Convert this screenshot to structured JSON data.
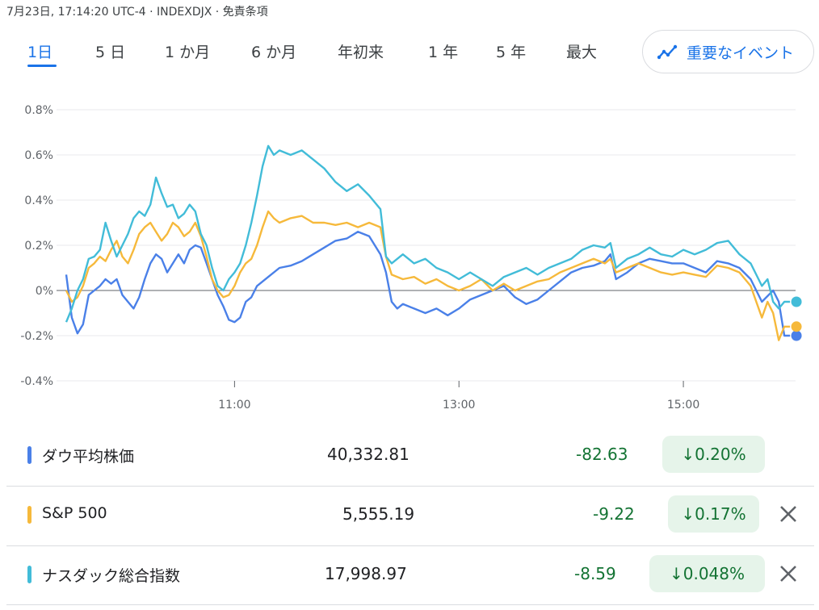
{
  "header": {
    "meta_text": "7月23日, 17:14:20 UTC-4 · INDEXDJX · 免責条項"
  },
  "tabs": [
    {
      "label": "1日",
      "active": true
    },
    {
      "label": "5 日",
      "active": false
    },
    {
      "label": "1 か月",
      "active": false
    },
    {
      "label": "6 か月",
      "active": false
    },
    {
      "label": "年初来",
      "active": false
    },
    {
      "label": "1 年",
      "active": false
    },
    {
      "label": "5 年",
      "active": false
    },
    {
      "label": "最大",
      "active": false
    }
  ],
  "events_button": {
    "label": "重要なイベント",
    "icon": "timeline-icon",
    "accent": "#1a73e8"
  },
  "chart_data": {
    "type": "line",
    "y_ticks": [
      "0.8%",
      "0.6%",
      "0.4%",
      "0.2%",
      "0%",
      "-0.2%",
      "-0.4%"
    ],
    "x_ticks": [
      "11:00",
      "13:00",
      "15:00"
    ],
    "ylim": [
      -0.4,
      0.8
    ],
    "x_unit": "time of day (hours)",
    "x_tick_values": [
      11,
      13,
      15
    ],
    "xlim": [
      9.5,
      16.0
    ],
    "zero_line": true,
    "series": [
      {
        "name": "ダウ平均株価",
        "color": "#4a80e8",
        "points": [
          [
            9.5,
            0.07
          ],
          [
            9.55,
            -0.12
          ],
          [
            9.6,
            -0.19
          ],
          [
            9.65,
            -0.15
          ],
          [
            9.7,
            -0.02
          ],
          [
            9.75,
            0.0
          ],
          [
            9.8,
            0.02
          ],
          [
            9.85,
            0.05
          ],
          [
            9.9,
            0.03
          ],
          [
            9.95,
            0.05
          ],
          [
            10.0,
            -0.02
          ],
          [
            10.05,
            -0.05
          ],
          [
            10.1,
            -0.08
          ],
          [
            10.15,
            -0.03
          ],
          [
            10.2,
            0.05
          ],
          [
            10.25,
            0.12
          ],
          [
            10.3,
            0.16
          ],
          [
            10.35,
            0.14
          ],
          [
            10.4,
            0.08
          ],
          [
            10.45,
            0.12
          ],
          [
            10.5,
            0.16
          ],
          [
            10.55,
            0.12
          ],
          [
            10.6,
            0.18
          ],
          [
            10.65,
            0.2
          ],
          [
            10.7,
            0.19
          ],
          [
            10.75,
            0.12
          ],
          [
            10.8,
            0.05
          ],
          [
            10.85,
            -0.02
          ],
          [
            10.9,
            -0.07
          ],
          [
            10.95,
            -0.13
          ],
          [
            11.0,
            -0.14
          ],
          [
            11.05,
            -0.12
          ],
          [
            11.1,
            -0.05
          ],
          [
            11.15,
            -0.03
          ],
          [
            11.2,
            0.02
          ],
          [
            11.3,
            0.06
          ],
          [
            11.4,
            0.1
          ],
          [
            11.5,
            0.11
          ],
          [
            11.6,
            0.13
          ],
          [
            11.7,
            0.16
          ],
          [
            11.8,
            0.19
          ],
          [
            11.9,
            0.22
          ],
          [
            12.0,
            0.23
          ],
          [
            12.1,
            0.26
          ],
          [
            12.2,
            0.24
          ],
          [
            12.3,
            0.16
          ],
          [
            12.35,
            0.08
          ],
          [
            12.4,
            -0.05
          ],
          [
            12.45,
            -0.08
          ],
          [
            12.5,
            -0.06
          ],
          [
            12.6,
            -0.08
          ],
          [
            12.7,
            -0.1
          ],
          [
            12.8,
            -0.08
          ],
          [
            12.9,
            -0.11
          ],
          [
            13.0,
            -0.08
          ],
          [
            13.1,
            -0.04
          ],
          [
            13.2,
            -0.02
          ],
          [
            13.3,
            0.0
          ],
          [
            13.4,
            0.02
          ],
          [
            13.5,
            -0.03
          ],
          [
            13.6,
            -0.06
          ],
          [
            13.7,
            -0.04
          ],
          [
            13.8,
            0.0
          ],
          [
            13.9,
            0.04
          ],
          [
            14.0,
            0.08
          ],
          [
            14.1,
            0.1
          ],
          [
            14.2,
            0.11
          ],
          [
            14.3,
            0.13
          ],
          [
            14.35,
            0.16
          ],
          [
            14.4,
            0.05
          ],
          [
            14.5,
            0.08
          ],
          [
            14.6,
            0.12
          ],
          [
            14.7,
            0.14
          ],
          [
            14.8,
            0.13
          ],
          [
            14.9,
            0.12
          ],
          [
            15.0,
            0.12
          ],
          [
            15.1,
            0.1
          ],
          [
            15.2,
            0.08
          ],
          [
            15.3,
            0.13
          ],
          [
            15.4,
            0.12
          ],
          [
            15.5,
            0.1
          ],
          [
            15.6,
            0.05
          ],
          [
            15.7,
            -0.05
          ],
          [
            15.8,
            0.0
          ],
          [
            15.85,
            -0.05
          ],
          [
            15.9,
            -0.2
          ],
          [
            15.95,
            -0.2
          ]
        ]
      },
      {
        "name": "S&P 500",
        "color": "#f6b93b",
        "points": [
          [
            9.5,
            0.0
          ],
          [
            9.55,
            -0.05
          ],
          [
            9.6,
            -0.03
          ],
          [
            9.65,
            0.02
          ],
          [
            9.7,
            0.1
          ],
          [
            9.75,
            0.12
          ],
          [
            9.8,
            0.15
          ],
          [
            9.85,
            0.13
          ],
          [
            9.9,
            0.18
          ],
          [
            9.95,
            0.22
          ],
          [
            10.0,
            0.15
          ],
          [
            10.05,
            0.12
          ],
          [
            10.1,
            0.18
          ],
          [
            10.15,
            0.25
          ],
          [
            10.2,
            0.28
          ],
          [
            10.25,
            0.3
          ],
          [
            10.3,
            0.26
          ],
          [
            10.35,
            0.22
          ],
          [
            10.4,
            0.25
          ],
          [
            10.45,
            0.3
          ],
          [
            10.5,
            0.28
          ],
          [
            10.55,
            0.24
          ],
          [
            10.6,
            0.26
          ],
          [
            10.65,
            0.3
          ],
          [
            10.7,
            0.24
          ],
          [
            10.75,
            0.15
          ],
          [
            10.8,
            0.05
          ],
          [
            10.85,
            0.0
          ],
          [
            10.9,
            -0.03
          ],
          [
            10.95,
            -0.02
          ],
          [
            11.0,
            0.02
          ],
          [
            11.05,
            0.08
          ],
          [
            11.1,
            0.12
          ],
          [
            11.15,
            0.14
          ],
          [
            11.2,
            0.2
          ],
          [
            11.25,
            0.28
          ],
          [
            11.3,
            0.35
          ],
          [
            11.35,
            0.32
          ],
          [
            11.4,
            0.3
          ],
          [
            11.5,
            0.32
          ],
          [
            11.6,
            0.33
          ],
          [
            11.7,
            0.3
          ],
          [
            11.8,
            0.3
          ],
          [
            11.9,
            0.29
          ],
          [
            12.0,
            0.3
          ],
          [
            12.1,
            0.28
          ],
          [
            12.2,
            0.3
          ],
          [
            12.3,
            0.28
          ],
          [
            12.35,
            0.15
          ],
          [
            12.4,
            0.07
          ],
          [
            12.5,
            0.05
          ],
          [
            12.6,
            0.06
          ],
          [
            12.7,
            0.03
          ],
          [
            12.8,
            0.05
          ],
          [
            12.9,
            0.02
          ],
          [
            13.0,
            0.0
          ],
          [
            13.1,
            0.02
          ],
          [
            13.2,
            0.05
          ],
          [
            13.3,
            0.0
          ],
          [
            13.4,
            0.03
          ],
          [
            13.5,
            0.0
          ],
          [
            13.6,
            0.02
          ],
          [
            13.7,
            0.04
          ],
          [
            13.8,
            0.05
          ],
          [
            13.9,
            0.08
          ],
          [
            14.0,
            0.1
          ],
          [
            14.1,
            0.12
          ],
          [
            14.2,
            0.14
          ],
          [
            14.3,
            0.12
          ],
          [
            14.35,
            0.14
          ],
          [
            14.4,
            0.08
          ],
          [
            14.5,
            0.1
          ],
          [
            14.6,
            0.12
          ],
          [
            14.7,
            0.1
          ],
          [
            14.8,
            0.08
          ],
          [
            14.9,
            0.07
          ],
          [
            15.0,
            0.08
          ],
          [
            15.1,
            0.07
          ],
          [
            15.2,
            0.06
          ],
          [
            15.3,
            0.11
          ],
          [
            15.4,
            0.1
          ],
          [
            15.5,
            0.08
          ],
          [
            15.6,
            0.02
          ],
          [
            15.7,
            -0.12
          ],
          [
            15.75,
            -0.05
          ],
          [
            15.8,
            -0.1
          ],
          [
            15.85,
            -0.22
          ],
          [
            15.9,
            -0.16
          ],
          [
            15.95,
            -0.16
          ]
        ]
      },
      {
        "name": "ナスダック総合指数",
        "color": "#42bcd8",
        "points": [
          [
            9.5,
            -0.14
          ],
          [
            9.55,
            -0.08
          ],
          [
            9.6,
            0.0
          ],
          [
            9.65,
            0.05
          ],
          [
            9.7,
            0.14
          ],
          [
            9.75,
            0.15
          ],
          [
            9.8,
            0.18
          ],
          [
            9.85,
            0.3
          ],
          [
            9.9,
            0.22
          ],
          [
            9.95,
            0.15
          ],
          [
            10.0,
            0.2
          ],
          [
            10.05,
            0.25
          ],
          [
            10.1,
            0.32
          ],
          [
            10.15,
            0.35
          ],
          [
            10.2,
            0.33
          ],
          [
            10.25,
            0.38
          ],
          [
            10.3,
            0.5
          ],
          [
            10.35,
            0.43
          ],
          [
            10.4,
            0.37
          ],
          [
            10.45,
            0.38
          ],
          [
            10.5,
            0.32
          ],
          [
            10.55,
            0.34
          ],
          [
            10.6,
            0.38
          ],
          [
            10.65,
            0.35
          ],
          [
            10.7,
            0.25
          ],
          [
            10.75,
            0.2
          ],
          [
            10.8,
            0.1
          ],
          [
            10.85,
            0.02
          ],
          [
            10.9,
            0.0
          ],
          [
            10.95,
            0.05
          ],
          [
            11.0,
            0.08
          ],
          [
            11.05,
            0.12
          ],
          [
            11.1,
            0.2
          ],
          [
            11.15,
            0.3
          ],
          [
            11.2,
            0.42
          ],
          [
            11.25,
            0.55
          ],
          [
            11.3,
            0.64
          ],
          [
            11.35,
            0.6
          ],
          [
            11.4,
            0.62
          ],
          [
            11.5,
            0.6
          ],
          [
            11.6,
            0.62
          ],
          [
            11.7,
            0.58
          ],
          [
            11.8,
            0.54
          ],
          [
            11.9,
            0.48
          ],
          [
            12.0,
            0.44
          ],
          [
            12.1,
            0.47
          ],
          [
            12.2,
            0.42
          ],
          [
            12.3,
            0.36
          ],
          [
            12.35,
            0.15
          ],
          [
            12.4,
            0.12
          ],
          [
            12.5,
            0.16
          ],
          [
            12.6,
            0.12
          ],
          [
            12.7,
            0.14
          ],
          [
            12.8,
            0.1
          ],
          [
            12.9,
            0.08
          ],
          [
            13.0,
            0.05
          ],
          [
            13.1,
            0.08
          ],
          [
            13.2,
            0.05
          ],
          [
            13.3,
            0.02
          ],
          [
            13.4,
            0.06
          ],
          [
            13.5,
            0.08
          ],
          [
            13.6,
            0.1
          ],
          [
            13.7,
            0.07
          ],
          [
            13.8,
            0.1
          ],
          [
            13.9,
            0.12
          ],
          [
            14.0,
            0.14
          ],
          [
            14.1,
            0.18
          ],
          [
            14.2,
            0.2
          ],
          [
            14.3,
            0.19
          ],
          [
            14.35,
            0.21
          ],
          [
            14.4,
            0.1
          ],
          [
            14.5,
            0.14
          ],
          [
            14.6,
            0.16
          ],
          [
            14.7,
            0.19
          ],
          [
            14.8,
            0.16
          ],
          [
            14.9,
            0.15
          ],
          [
            15.0,
            0.18
          ],
          [
            15.1,
            0.16
          ],
          [
            15.2,
            0.18
          ],
          [
            15.3,
            0.21
          ],
          [
            15.4,
            0.22
          ],
          [
            15.5,
            0.16
          ],
          [
            15.6,
            0.12
          ],
          [
            15.7,
            0.02
          ],
          [
            15.75,
            0.05
          ],
          [
            15.8,
            -0.05
          ],
          [
            15.85,
            -0.08
          ],
          [
            15.9,
            -0.05
          ],
          [
            15.95,
            -0.05
          ]
        ]
      }
    ]
  },
  "quotes": [
    {
      "name": "ダウ平均株価",
      "color": "#4a80e8",
      "price": "40,332.81",
      "change": "-82.63",
      "pct": "↓0.20%",
      "removable": false
    },
    {
      "name": "S&P 500",
      "color": "#f6b93b",
      "price": "5,555.19",
      "change": "-9.22",
      "pct": "↓0.17%",
      "removable": true
    },
    {
      "name": "ナスダック総合指数",
      "color": "#42bcd8",
      "price": "17,998.97",
      "change": "-8.59",
      "pct": "↓0.048%",
      "removable": true
    }
  ]
}
